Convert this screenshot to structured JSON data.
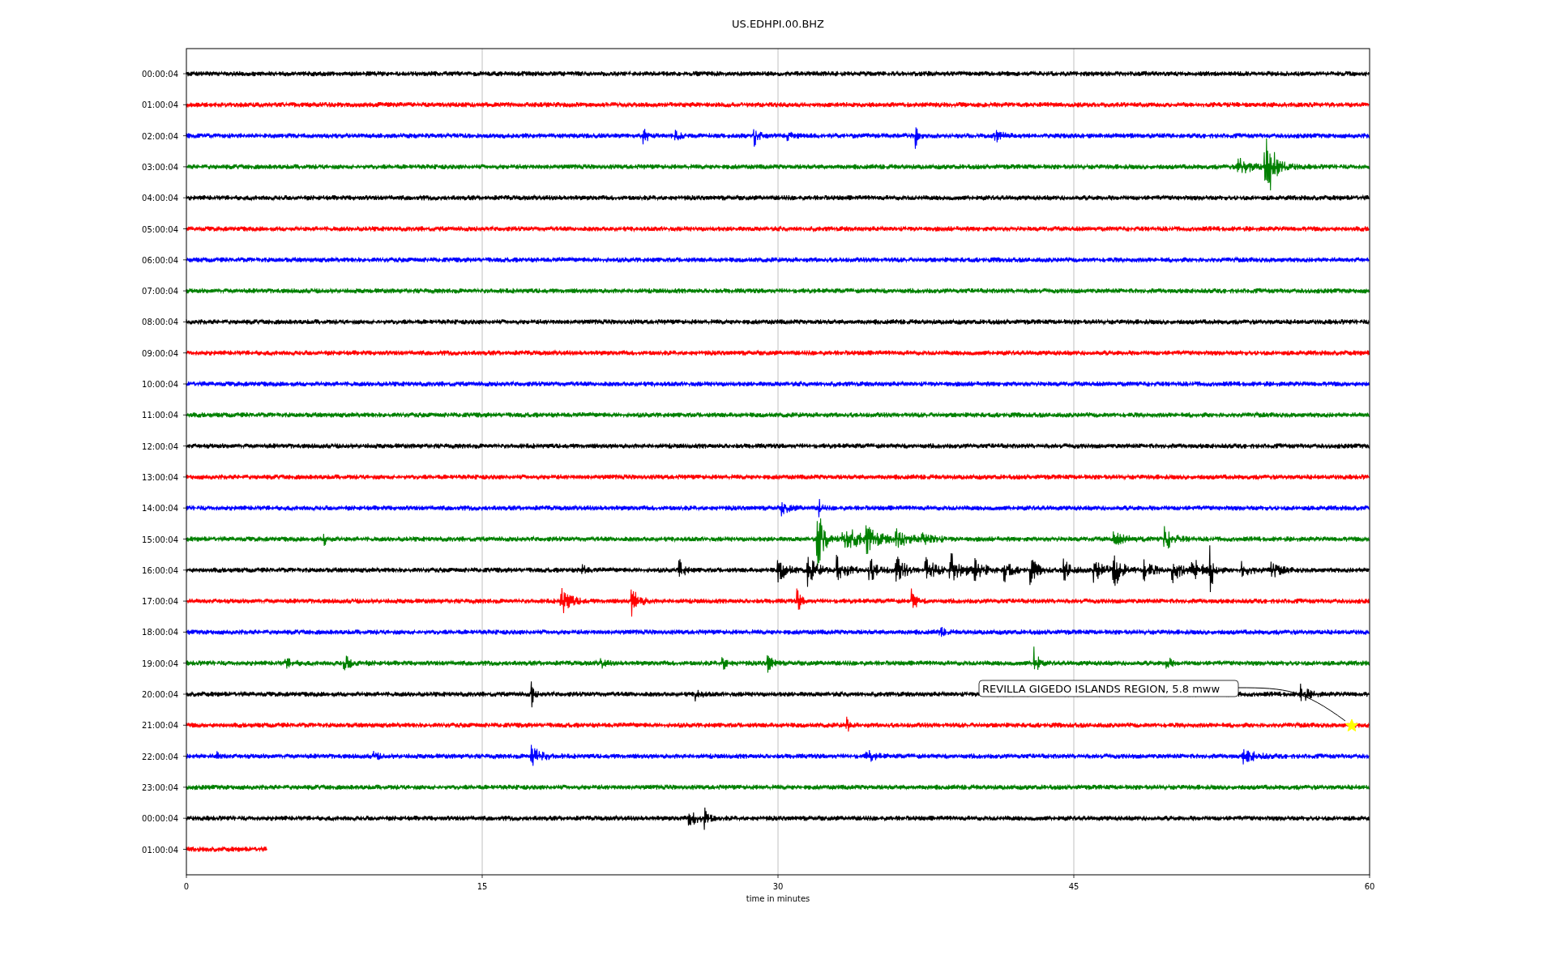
{
  "title": "US.EDHPI.00.BHZ",
  "rows": [
    {
      "label": "00:00:04",
      "color": "#000000"
    },
    {
      "label": "01:00:04",
      "color": "#ff0000"
    },
    {
      "label": "02:00:04",
      "color": "#0000ff"
    },
    {
      "label": "03:00:04",
      "color": "#008000"
    },
    {
      "label": "04:00:04",
      "color": "#000000"
    },
    {
      "label": "05:00:04",
      "color": "#ff0000"
    },
    {
      "label": "06:00:04",
      "color": "#0000ff"
    },
    {
      "label": "07:00:04",
      "color": "#008000"
    },
    {
      "label": "08:00:04",
      "color": "#000000"
    },
    {
      "label": "09:00:04",
      "color": "#ff0000"
    },
    {
      "label": "10:00:04",
      "color": "#0000ff"
    },
    {
      "label": "11:00:04",
      "color": "#008000"
    },
    {
      "label": "12:00:04",
      "color": "#000000"
    },
    {
      "label": "13:00:04",
      "color": "#ff0000"
    },
    {
      "label": "14:00:04",
      "color": "#0000ff"
    },
    {
      "label": "15:00:04",
      "color": "#008000"
    },
    {
      "label": "16:00:04",
      "color": "#000000"
    },
    {
      "label": "17:00:04",
      "color": "#ff0000"
    },
    {
      "label": "18:00:04",
      "color": "#0000ff"
    },
    {
      "label": "19:00:04",
      "color": "#008000"
    },
    {
      "label": "20:00:04",
      "color": "#000000"
    },
    {
      "label": "21:00:04",
      "color": "#ff0000"
    },
    {
      "label": "22:00:04",
      "color": "#0000ff"
    },
    {
      "label": "23:00:04",
      "color": "#008000"
    },
    {
      "label": "00:00:04",
      "color": "#000000"
    },
    {
      "label": "01:00:04",
      "color": "#ff0000"
    }
  ],
  "x_ticks": [
    "0",
    "15",
    "30",
    "45",
    "60"
  ],
  "x_label": "time in minutes",
  "annotation": {
    "text": "REVILLA GIGEDO ISLANDS REGION, 5.8 mww"
  }
}
